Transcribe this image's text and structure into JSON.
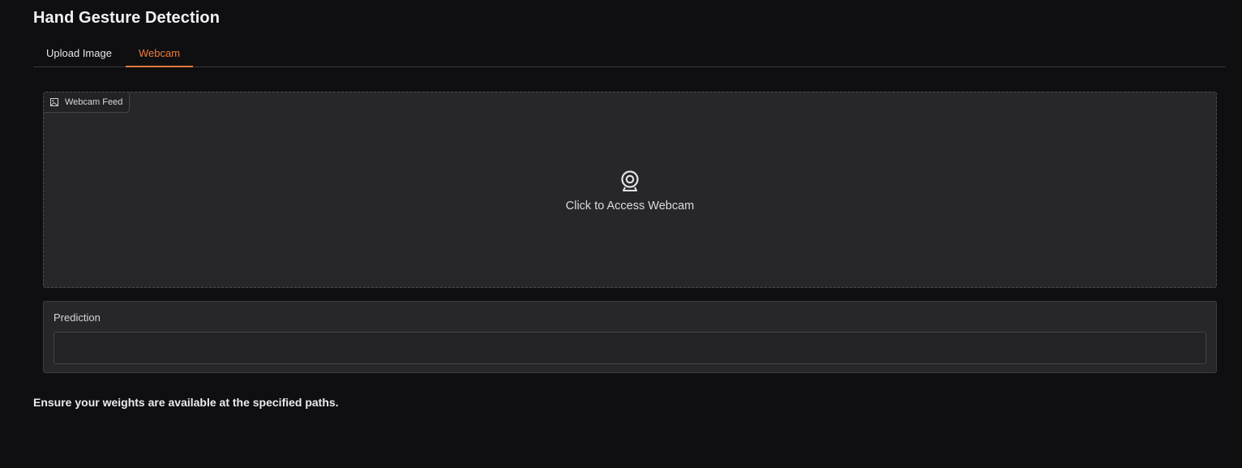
{
  "app": {
    "title": "Hand Gesture Detection"
  },
  "tabs": [
    {
      "label": "Upload Image",
      "selected": false
    },
    {
      "label": "Webcam",
      "selected": true
    }
  ],
  "webcam": {
    "label": "Webcam Feed",
    "label_icon": "image-icon",
    "center_icon": "webcam-icon",
    "cta": "Click to Access Webcam"
  },
  "prediction": {
    "label": "Prediction",
    "value": ""
  },
  "footer": {
    "note": "Ensure your weights are available at the specified paths."
  },
  "colors": {
    "background": "#0f0f11",
    "panel": "#27272a",
    "accent": "#ee7a3b",
    "text": "#e8e8ea"
  }
}
